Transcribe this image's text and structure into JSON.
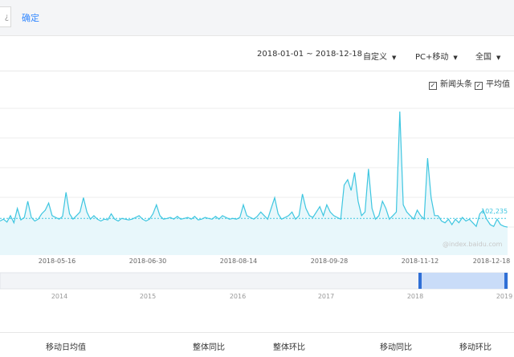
{
  "toolbar": {
    "input_fragment": "¿",
    "confirm_label": "确定"
  },
  "filters": {
    "date_range": "2018-01-01 ~ 2018-12-18",
    "period_select": "自定义",
    "device_select": "PC+移动",
    "region_select": "全国"
  },
  "legend": {
    "items": [
      {
        "label": "新闻头条",
        "checked": true
      },
      {
        "label": "平均值",
        "checked": true
      }
    ]
  },
  "chart_data": {
    "type": "line",
    "x_tick_labels": [
      "2018-05-16",
      "2018-06-30",
      "2018-08-14",
      "2018-09-28",
      "2018-11-12",
      "2018-12-18"
    ],
    "average_value_label": "102,235",
    "watermark": "@index.baidu.com",
    "series": [
      {
        "name": "新闻头条",
        "color": "#3ec6e0",
        "values": [
          95,
          100,
          92,
          110,
          90,
          130,
          98,
          105,
          150,
          105,
          95,
          100,
          115,
          125,
          145,
          110,
          105,
          100,
          108,
          175,
          115,
          100,
          110,
          120,
          160,
          120,
          100,
          110,
          100,
          95,
          100,
          98,
          115,
          100,
          95,
          102,
          100,
          98,
          100,
          105,
          110,
          100,
          95,
          100,
          115,
          140,
          110,
          100,
          102,
          105,
          100,
          108,
          100,
          102,
          105,
          100,
          108,
          98,
          100,
          105,
          102,
          100,
          108,
          100,
          110,
          105,
          100,
          102,
          100,
          105,
          140,
          110,
          105,
          100,
          108,
          120,
          110,
          100,
          130,
          160,
          115,
          100,
          105,
          110,
          120,
          100,
          110,
          170,
          130,
          110,
          105,
          120,
          135,
          110,
          140,
          120,
          110,
          105,
          100,
          195,
          210,
          180,
          230,
          150,
          110,
          120,
          240,
          130,
          100,
          110,
          150,
          130,
          100,
          110,
          120,
          400,
          140,
          120,
          110,
          100,
          125,
          110,
          100,
          270,
          160,
          110,
          110,
          95,
          90,
          100,
          85,
          100,
          90,
          105,
          95,
          100,
          90,
          80,
          115,
          125,
          100,
          85,
          80,
          100,
          85,
          80,
          78
        ],
        "average": 102235
      }
    ],
    "navigator": {
      "year_labels": [
        "2014",
        "2015",
        "2016",
        "2017",
        "2018",
        "2019"
      ],
      "selection": "2018-01-01 ~ 2018-12-18"
    }
  },
  "bottom_stats": {
    "labels": [
      "移动日均值",
      "整体同比",
      "整体环比",
      "移动同比",
      "移动环比"
    ]
  },
  "colors": {
    "accent": "#3388ff",
    "line": "#3ec6e0",
    "navigator_fill": "#c9dcf8",
    "navigator_handle": "#2f6fd6"
  }
}
